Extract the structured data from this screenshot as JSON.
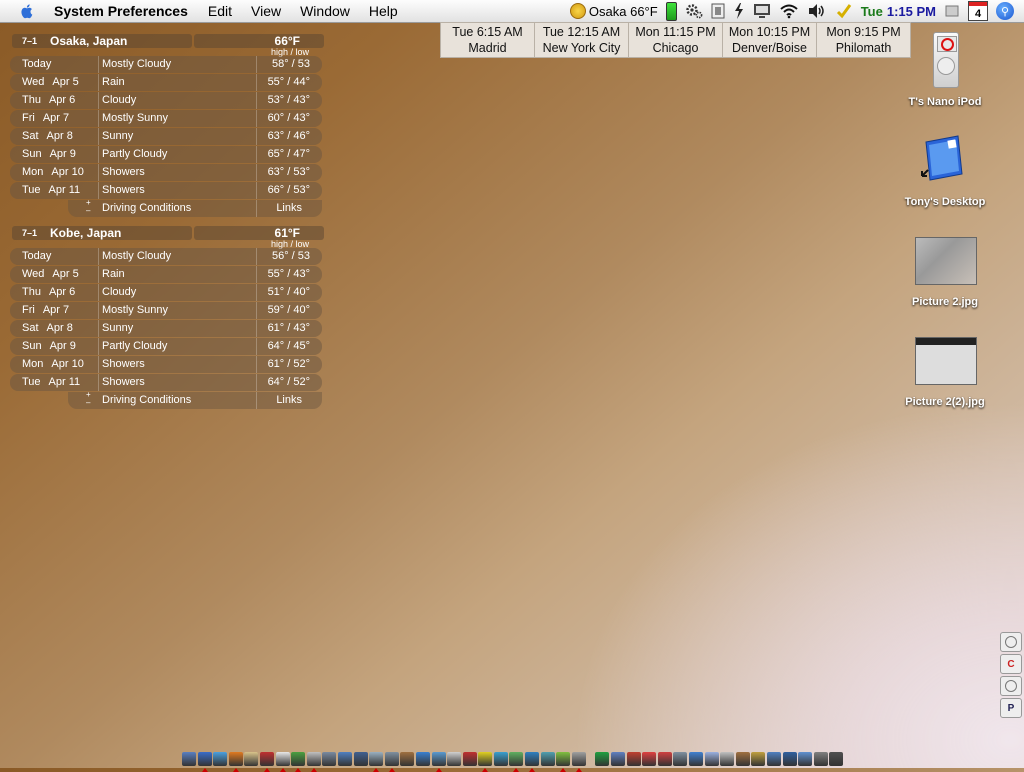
{
  "menubar": {
    "app": "System Preferences",
    "items": [
      "Edit",
      "View",
      "Window",
      "Help"
    ],
    "weather": "Osaka 66°F",
    "clock_day": "Tue",
    "clock_time": "1:15 PM",
    "calendar_day": "4"
  },
  "world_clocks": [
    {
      "time": "Tue  6:15 AM",
      "city": "Madrid"
    },
    {
      "time": "Tue  12:15 AM",
      "city": "New York City"
    },
    {
      "time": "Mon  11:15 PM",
      "city": "Chicago"
    },
    {
      "time": "Mon  10:15 PM",
      "city": "Denver/Boise"
    },
    {
      "time": "Mon  9:15 PM",
      "city": "Philomath"
    }
  ],
  "weather_widgets": [
    {
      "id": "7–1",
      "city": "Osaka, Japan",
      "temp": "66°F",
      "hl_label": "high / low",
      "rows": [
        {
          "day": "Today",
          "date": "",
          "cond": "Mostly Cloudy",
          "temp": "58° / 53"
        },
        {
          "day": "Wed",
          "date": "Apr 5",
          "cond": "Rain",
          "temp": "55° / 44°"
        },
        {
          "day": "Thu",
          "date": "Apr 6",
          "cond": "Cloudy",
          "temp": "53° / 43°"
        },
        {
          "day": "Fri",
          "date": "Apr 7",
          "cond": "Mostly Sunny",
          "temp": "60° / 43°"
        },
        {
          "day": "Sat",
          "date": "Apr 8",
          "cond": "Sunny",
          "temp": "63° / 46°"
        },
        {
          "day": "Sun",
          "date": "Apr 9",
          "cond": "Partly Cloudy",
          "temp": "65° / 47°"
        },
        {
          "day": "Mon",
          "date": "Apr 10",
          "cond": "Showers",
          "temp": "63° / 53°"
        },
        {
          "day": "Tue",
          "date": "Apr 11",
          "cond": "Showers",
          "temp": "66° / 53°"
        }
      ],
      "footer_left": "Driving Conditions",
      "footer_right": "Links"
    },
    {
      "id": "7–1",
      "city": "Kobe, Japan",
      "temp": "61°F",
      "hl_label": "high / low",
      "rows": [
        {
          "day": "Today",
          "date": "",
          "cond": "Mostly Cloudy",
          "temp": "56° / 53"
        },
        {
          "day": "Wed",
          "date": "Apr 5",
          "cond": "Rain",
          "temp": "55° / 43°"
        },
        {
          "day": "Thu",
          "date": "Apr 6",
          "cond": "Cloudy",
          "temp": "51° / 40°"
        },
        {
          "day": "Fri",
          "date": "Apr 7",
          "cond": "Mostly Sunny",
          "temp": "59° / 40°"
        },
        {
          "day": "Sat",
          "date": "Apr 8",
          "cond": "Sunny",
          "temp": "61° / 43°"
        },
        {
          "day": "Sun",
          "date": "Apr 9",
          "cond": "Partly Cloudy",
          "temp": "64° / 45°"
        },
        {
          "day": "Mon",
          "date": "Apr 10",
          "cond": "Showers",
          "temp": "61° / 52°"
        },
        {
          "day": "Tue",
          "date": "Apr 11",
          "cond": "Showers",
          "temp": "64° / 52°"
        }
      ],
      "footer_left": "Driving Conditions",
      "footer_right": "Links"
    }
  ],
  "desktop_icons": [
    {
      "label": "T's Nano iPod"
    },
    {
      "label": "Tony's Desktop"
    },
    {
      "label": "Picture 2.jpg"
    },
    {
      "label": "Picture 2(2).jpg"
    }
  ],
  "side_tabs": [
    "C",
    "P"
  ],
  "dock_colors": [
    "#5a7fc0",
    "#3a6cc8",
    "#4aa0e0",
    "#e07a20",
    "#d9c38a",
    "#c03030",
    "#e8e8e8",
    "#4aa040",
    "#c0c0c0",
    "#7a8aa0",
    "#5080c0",
    "#406090",
    "#9ab0c0",
    "#8090a0",
    "#a07040",
    "#3a80d0",
    "#5a9ad0",
    "#d0d0d0",
    "#c03030",
    "#e0d020",
    "#3aa0d0",
    "#60b060",
    "#3080c0",
    "#50a0b0",
    "#80c040",
    "#a0a0a0",
    "#20a040",
    "#6080c0",
    "#c04030",
    "#e04040",
    "#d04040",
    "#8090a0",
    "#4080d0",
    "#9ab0e0",
    "#c0c0c0",
    "#a07040",
    "#c0a040",
    "#5080c0",
    "#3060a0",
    "#6090d0",
    "#808080",
    "#505050"
  ]
}
